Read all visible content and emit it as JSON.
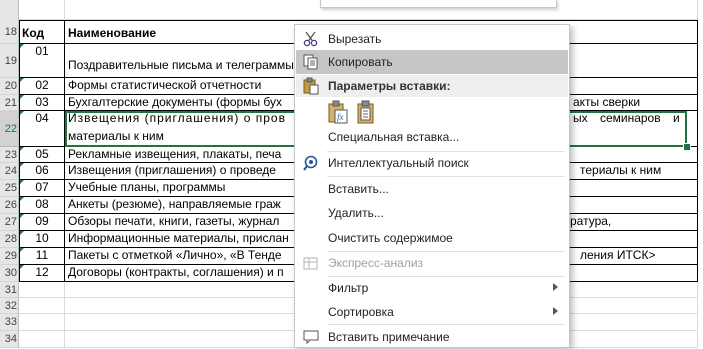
{
  "sheet": {
    "header": {
      "row": "18",
      "code": "Код",
      "name": "Наименование"
    },
    "rows": [
      {
        "num": "19",
        "code": "01",
        "name": "Поздравительные письма и телеграммы"
      },
      {
        "num": "20",
        "code": "02",
        "name": "Формы статистической отчетности"
      },
      {
        "num": "21",
        "code": "03",
        "name": "Бухгалтерские документы (формы бух",
        "tail": "акты сверки"
      },
      {
        "num": "22",
        "code": "04",
        "name_line1_start": "Извещения (приглашения) о пров",
        "name_line1_end": "ых семинаров и",
        "name_line2": "материалы к ним"
      },
      {
        "num": "23",
        "code": "05",
        "name": "Рекламные извещения, плакаты, печа"
      },
      {
        "num": "24",
        "code": "06",
        "name": "Извещения (приглашения) о проведе",
        "tail": "териалы к ним"
      },
      {
        "num": "25",
        "code": "07",
        "name": "Учебные планы, программы"
      },
      {
        "num": "26",
        "code": "08",
        "name": "Анкеты (резюме), направляемые граж"
      },
      {
        "num": "27",
        "code": "09",
        "name": "Обзоры печати, книги, газеты, журнал",
        "tail": "ратура,"
      },
      {
        "num": "28",
        "code": "10",
        "name": "Информационные материалы, прислан"
      },
      {
        "num": "29",
        "code": "11",
        "name": "Пакеты с отметкой «Лично», «В Тенде",
        "tail": "ления ИТСК>"
      },
      {
        "num": "30",
        "code": "12",
        "name": "Договоры (контракты, соглашения) и п"
      },
      {
        "num": "31"
      },
      {
        "num": "32"
      },
      {
        "num": "33"
      },
      {
        "num": "34"
      }
    ]
  },
  "context_menu": {
    "cut": "Вырезать",
    "copy": "Копировать",
    "paste_options": "Параметры вставки:",
    "paste_special": "Специальная вставка...",
    "smart_lookup": "Интеллектуальный поиск",
    "insert": "Вставить...",
    "delete": "Удалить...",
    "clear_contents": "Очистить содержимое",
    "quick_analysis": "Экспресс-анализ",
    "filter": "Фильтр",
    "sort": "Сортировка",
    "insert_comment": "Вставить примечание"
  },
  "colors": {
    "selection": "#217346",
    "menu_highlight": "#c6c6c6"
  }
}
